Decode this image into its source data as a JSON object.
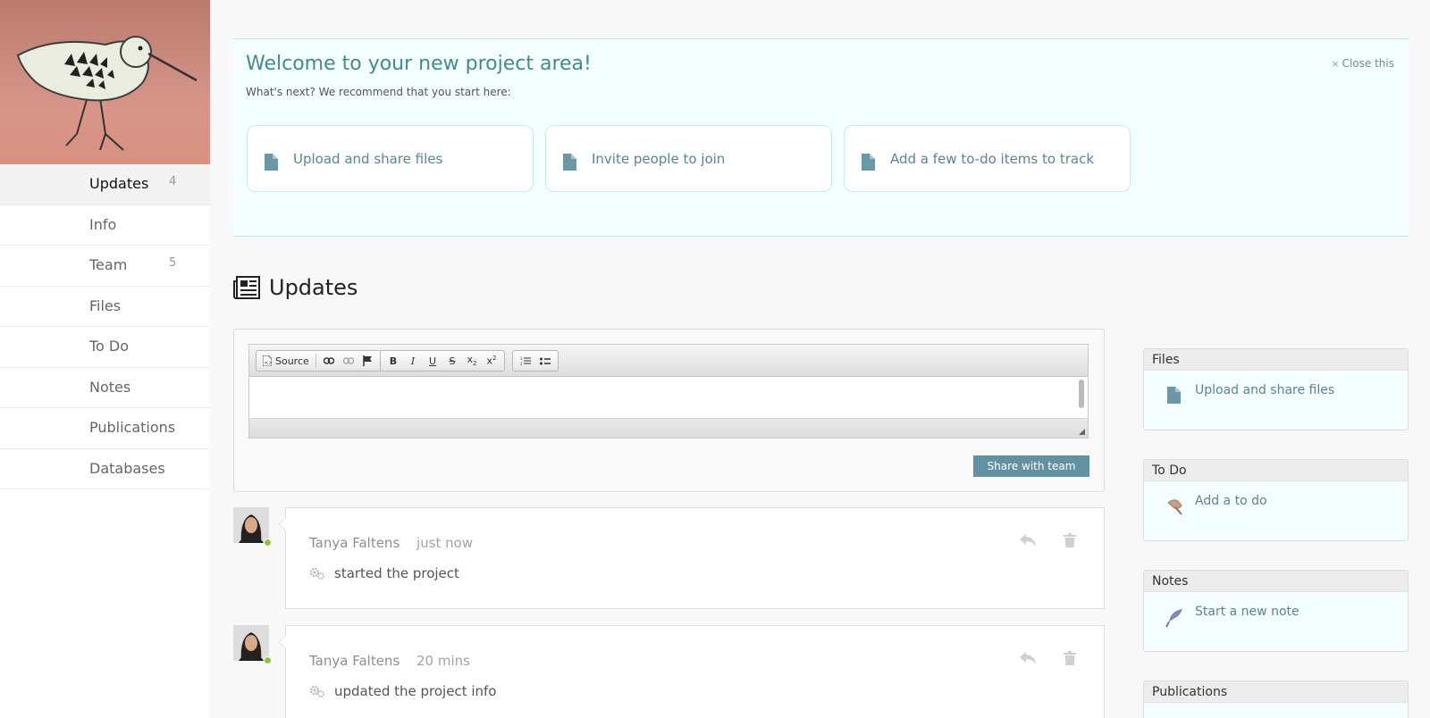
{
  "sidebar": {
    "items": [
      {
        "label": "Updates",
        "count": "4"
      },
      {
        "label": "Info",
        "count": ""
      },
      {
        "label": "Team",
        "count": "5"
      },
      {
        "label": "Files",
        "count": ""
      },
      {
        "label": "To Do",
        "count": ""
      },
      {
        "label": "Notes",
        "count": ""
      },
      {
        "label": "Publications",
        "count": ""
      },
      {
        "label": "Databases",
        "count": ""
      }
    ]
  },
  "welcome": {
    "title": "Welcome to your new project area!",
    "subtitle": "What's next? We recommend that you start here:",
    "close_label": "Close this",
    "close_glyph": "×",
    "cards": [
      {
        "label": "Upload and share files",
        "icon": "document-icon"
      },
      {
        "label": "Invite people to join",
        "icon": "document-icon"
      },
      {
        "label": "Add a few to-do items to track",
        "icon": "document-icon"
      }
    ]
  },
  "updates": {
    "title": "Updates",
    "editor": {
      "source_label": "Source",
      "share_button": "Share with team"
    },
    "feed": [
      {
        "user": "Tanya Faltens",
        "time": "just now",
        "action": "started the project"
      },
      {
        "user": "Tanya Faltens",
        "time": "20 mins",
        "action": "updated the project info"
      }
    ]
  },
  "widgets": {
    "files": {
      "title": "Files",
      "action": "Upload and share files",
      "icon": "document-icon"
    },
    "todo": {
      "title": "To Do",
      "action": "Add a to do",
      "icon": "pushpin-icon"
    },
    "notes": {
      "title": "Notes",
      "action": "Start a new note",
      "icon": "quill-icon"
    },
    "publications": {
      "title": "Publications"
    }
  },
  "colors": {
    "accent": "#3f8d8c",
    "link": "#5a8594",
    "button": "#6490a3",
    "online": "#8cc63f"
  }
}
